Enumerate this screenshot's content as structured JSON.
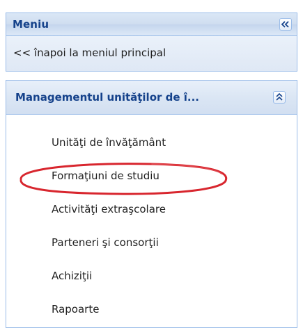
{
  "header": {
    "title": "Meniu",
    "collapse_icon": "double-chevron-left-icon"
  },
  "back_link": {
    "label": "<< înapoi la meniul principal"
  },
  "section": {
    "title": "Managementul unităţilor de î...",
    "collapse_icon": "double-chevron-up-icon",
    "items": [
      {
        "label": "Unităţi de învăţământ"
      },
      {
        "label": "Formaţiuni de studiu",
        "highlighted": true
      },
      {
        "label": "Activităţi extraşcolare"
      },
      {
        "label": "Parteneri şi consorţii"
      },
      {
        "label": "Achiziţii"
      },
      {
        "label": "Rapoarte"
      }
    ]
  },
  "colors": {
    "header_text": "#15428b",
    "border": "#99bbe8",
    "highlight": "#d8262e"
  }
}
